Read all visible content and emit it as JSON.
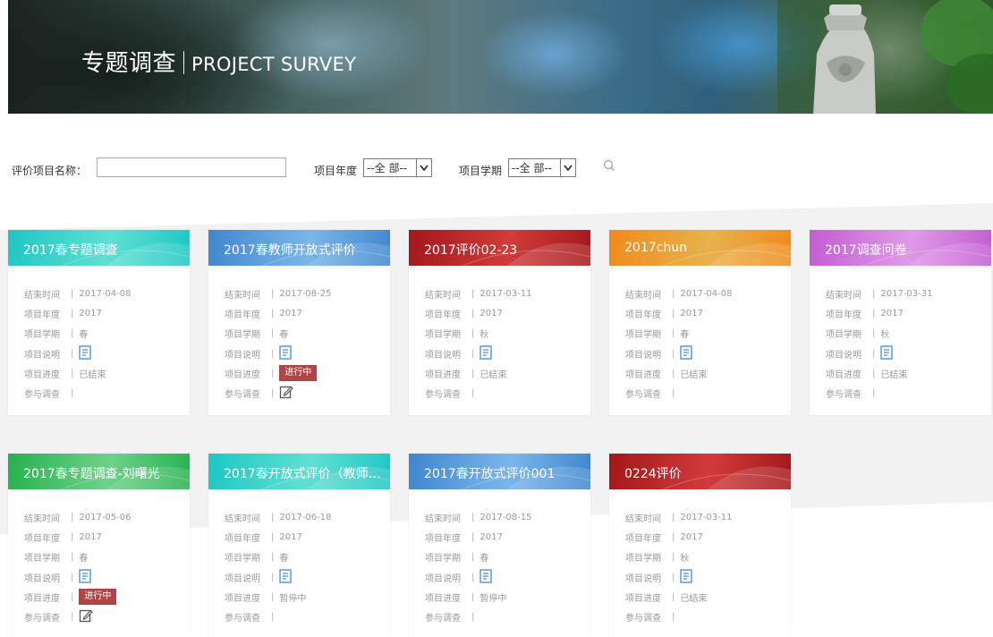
{
  "banner": {
    "title_cn": "专题调查",
    "title_en": "PROJECT SURVEY"
  },
  "filter": {
    "name_label": "评价项目名称：",
    "name_value": "",
    "year_label": "项目年度",
    "year_selected": "--全 部--",
    "term_label": "项目学期",
    "term_selected": "--全 部--",
    "search_icon": "search-icon"
  },
  "field_labels": {
    "end_time": "结束时间",
    "year": "项目年度",
    "term": "项目学期",
    "desc": "项目说明",
    "progress": "项目进度",
    "join": "参与调查",
    "sep": "|"
  },
  "cards": [
    {
      "title": "2017春专题调查",
      "end_time": "2017-04-08",
      "year": "2017",
      "term": "春",
      "progress": "已结束",
      "active": false,
      "theme": "#1ec6c4",
      "theme2": "#5fe0d2"
    },
    {
      "title": "2017春教师开放式评价",
      "end_time": "2017-08-25",
      "year": "2017",
      "term": "春",
      "progress": "进行中",
      "active": true,
      "theme": "#3f86cf",
      "theme2": "#7ab6ea"
    },
    {
      "title": "2017评价02-23",
      "end_time": "2017-03-11",
      "year": "2017",
      "term": "秋",
      "progress": "已结束",
      "active": false,
      "theme": "#a3171a",
      "theme2": "#d23b3b"
    },
    {
      "title": "2017chun",
      "end_time": "2017-04-08",
      "year": "2017",
      "term": "春",
      "progress": "已结束",
      "active": false,
      "theme": "#f08a1a",
      "theme2": "#e8b24d"
    },
    {
      "title": "2017调查问卷",
      "end_time": "2017-03-31",
      "year": "2017",
      "term": "秋",
      "progress": "已结束",
      "active": false,
      "theme": "#c45bd4",
      "theme2": "#df9ae6"
    },
    {
      "title": "2017春专题调查-刘曙光",
      "end_time": "2017-05-06",
      "year": "2017",
      "term": "春",
      "progress": "进行中",
      "active": true,
      "theme": "#25b14f",
      "theme2": "#6fd18a"
    },
    {
      "title": "2017春开放式评价（教师…",
      "end_time": "2017-06-18",
      "year": "2017",
      "term": "春",
      "progress": "暂停中",
      "active": false,
      "theme": "#1ec6c4",
      "theme2": "#5fe0d2"
    },
    {
      "title": "2017春开放式评价001",
      "end_time": "2017-08-15",
      "year": "2017",
      "term": "春",
      "progress": "暂停中",
      "active": false,
      "theme": "#3f86cf",
      "theme2": "#7ab6ea"
    },
    {
      "title": "0224评价",
      "end_time": "2017-03-11",
      "year": "2017",
      "term": "秋",
      "progress": "已结束",
      "active": false,
      "theme": "#a3171a",
      "theme2": "#d23b3b"
    }
  ],
  "colors": {
    "badge": "#b04545",
    "icon_blue": "#3b8fd9",
    "icon_gray": "#666666"
  }
}
